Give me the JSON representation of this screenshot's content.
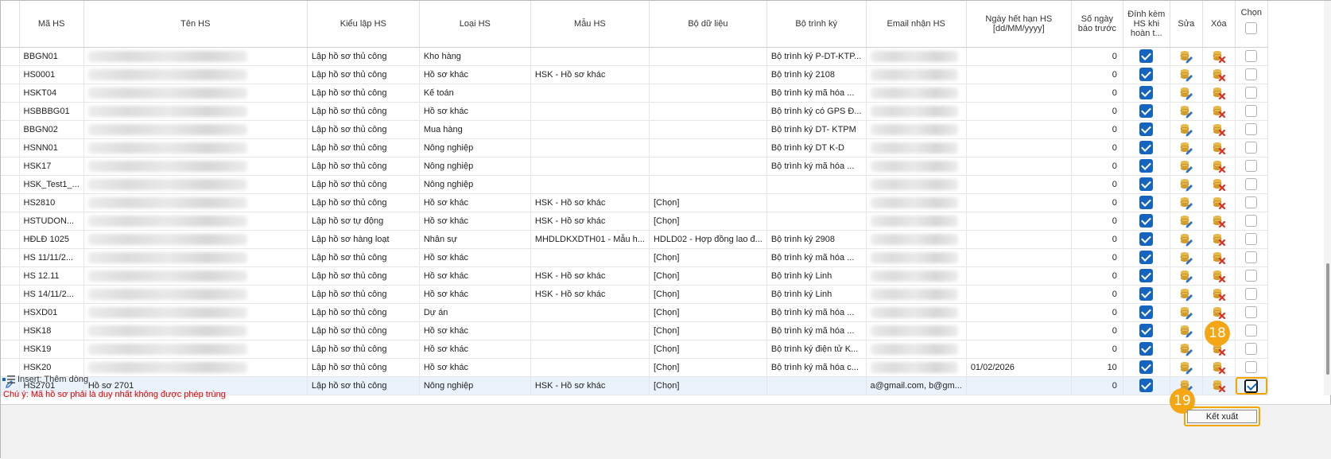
{
  "table": {
    "headers": {
      "ma_hs": "Mã HS",
      "ten_hs": "Tên HS",
      "kieu_lap_hs": "Kiểu lập HS",
      "loai_hs": "Loại HS",
      "mau_hs": "Mẫu HS",
      "bo_du_lieu": "Bộ dữ liệu",
      "bo_trinh_ky": "Bộ trình ký",
      "email_nhan_hs": "Email nhận HS",
      "ngay_het_han": "Ngày hết hạn HS [dd/MM/yyyy]",
      "so_ngay_bao_truoc": "Số ngày báo trước",
      "dinh_kem": "Đính kèm HS khi hoàn t...",
      "sua": "Sửa",
      "xoa": "Xóa",
      "chon": "Chọn"
    },
    "rows": [
      {
        "ma": "BBGN01",
        "ten": "",
        "kieu": "Lập hồ sơ thủ công",
        "loai": "Kho hàng",
        "mau": "",
        "bo_dl": "",
        "trinh_ky": "Bộ trình ký P-DT-KTP...",
        "email": "",
        "ngay": "",
        "so_ngay": "0",
        "dinh_kem": true,
        "chon": false
      },
      {
        "ma": "HS0001",
        "ten": "",
        "kieu": "Lập hồ sơ thủ công",
        "loai": "Hồ sơ khác",
        "mau": "HSK - Hồ sơ khác",
        "bo_dl": "",
        "trinh_ky": "Bộ trình ký 2108",
        "email": "",
        "ngay": "",
        "so_ngay": "0",
        "dinh_kem": true,
        "chon": false
      },
      {
        "ma": "HSKT04",
        "ten": "",
        "kieu": "Lập hồ sơ thủ công",
        "loai": "Kế toán",
        "mau": "",
        "bo_dl": "",
        "trinh_ky": "Bộ trình ký mã hóa ...",
        "email": "",
        "ngay": "",
        "so_ngay": "0",
        "dinh_kem": true,
        "chon": false
      },
      {
        "ma": "HSBBBG01",
        "ten": "",
        "kieu": "Lập hồ sơ thủ công",
        "loai": "Hồ sơ khác",
        "mau": "",
        "bo_dl": "",
        "trinh_ky": "Bộ trình ký có GPS Đ...",
        "email": "",
        "ngay": "",
        "so_ngay": "0",
        "dinh_kem": true,
        "chon": false
      },
      {
        "ma": "BBGN02",
        "ten": "",
        "kieu": "Lập hồ sơ thủ công",
        "loai": "Mua hàng",
        "mau": "",
        "bo_dl": "",
        "trinh_ky": "Bộ trình ký DT- KTPM",
        "email": "",
        "ngay": "",
        "so_ngay": "0",
        "dinh_kem": true,
        "chon": false
      },
      {
        "ma": "HSNN01",
        "ten": "",
        "kieu": "Lập hồ sơ thủ công",
        "loai": "Nông nghiệp",
        "mau": "",
        "bo_dl": "",
        "trinh_ky": "Bộ trình ký DT K-D",
        "email": "",
        "ngay": "",
        "so_ngay": "0",
        "dinh_kem": true,
        "chon": false
      },
      {
        "ma": "HSK17",
        "ten": "",
        "kieu": "Lập hồ sơ thủ công",
        "loai": "Nông nghiệp",
        "mau": "",
        "bo_dl": "",
        "trinh_ky": "Bộ trình ký mã hóa ...",
        "email": "",
        "ngay": "",
        "so_ngay": "0",
        "dinh_kem": true,
        "chon": false
      },
      {
        "ma": "HSK_Test1_...",
        "ten": "",
        "kieu": "Lập hồ sơ thủ công",
        "loai": "Nông nghiệp",
        "mau": "",
        "bo_dl": "",
        "trinh_ky": "",
        "email": "",
        "ngay": "",
        "so_ngay": "0",
        "dinh_kem": true,
        "chon": false
      },
      {
        "ma": "HS2810",
        "ten": "",
        "kieu": "Lập hồ sơ thủ công",
        "loai": "Hồ sơ khác",
        "mau": "HSK - Hồ sơ khác",
        "bo_dl": "[Chọn]",
        "trinh_ky": "",
        "email": "",
        "ngay": "",
        "so_ngay": "0",
        "dinh_kem": true,
        "chon": false
      },
      {
        "ma": "HSTUDON...",
        "ten": "",
        "kieu": "Lập hồ sơ tự động",
        "loai": "Hồ sơ khác",
        "mau": "HSK - Hồ sơ khác",
        "bo_dl": "[Chọn]",
        "trinh_ky": "",
        "email": "",
        "ngay": "",
        "so_ngay": "0",
        "dinh_kem": true,
        "chon": false
      },
      {
        "ma": "HĐLĐ 1025",
        "ten": "",
        "kieu": "Lập hồ sơ hàng loạt",
        "loai": "Nhân sự",
        "mau": "MHDLDKXDTH01 - Mẫu h...",
        "bo_dl": "HDLD02 - Hợp đồng lao đ...",
        "trinh_ky": "Bộ trình ký 2908",
        "email": "",
        "ngay": "",
        "so_ngay": "0",
        "dinh_kem": true,
        "chon": false
      },
      {
        "ma": "HS 11/11/2...",
        "ten": "",
        "kieu": "Lập hồ sơ thủ công",
        "loai": "Hồ sơ khác",
        "mau": "",
        "bo_dl": "[Chọn]",
        "trinh_ky": "Bộ trình ký mã hóa ...",
        "email": "",
        "ngay": "",
        "so_ngay": "0",
        "dinh_kem": true,
        "chon": false
      },
      {
        "ma": "HS 12.11",
        "ten": "",
        "kieu": "Lập hồ sơ thủ công",
        "loai": "Hồ sơ khác",
        "mau": "HSK - Hồ sơ khác",
        "bo_dl": "[Chọn]",
        "trinh_ky": "Bộ trình ký Linh",
        "email": "",
        "ngay": "",
        "so_ngay": "0",
        "dinh_kem": true,
        "chon": false
      },
      {
        "ma": "HS 14/11/2...",
        "ten": "",
        "kieu": "Lập hồ sơ thủ công",
        "loai": "Hồ sơ khác",
        "mau": "HSK - Hồ sơ khác",
        "bo_dl": "[Chọn]",
        "trinh_ky": "Bộ trình ký Linh",
        "email": "",
        "ngay": "",
        "so_ngay": "0",
        "dinh_kem": true,
        "chon": false
      },
      {
        "ma": "HSXD01",
        "ten": "",
        "kieu": "Lập hồ sơ thủ công",
        "loai": "Dự án",
        "mau": "",
        "bo_dl": "[Chọn]",
        "trinh_ky": "Bộ trình ký mã hóa ...",
        "email": "",
        "ngay": "",
        "so_ngay": "0",
        "dinh_kem": true,
        "chon": false
      },
      {
        "ma": "HSK18",
        "ten": "",
        "kieu": "Lập hồ sơ thủ công",
        "loai": "Hồ sơ khác",
        "mau": "",
        "bo_dl": "[Chọn]",
        "trinh_ky": "Bộ trình ký mã hóa ...",
        "email": "",
        "ngay": "",
        "so_ngay": "0",
        "dinh_kem": true,
        "chon": false
      },
      {
        "ma": "HSK19",
        "ten": "",
        "kieu": "Lập hồ sơ thủ công",
        "loai": "Hồ sơ khác",
        "mau": "",
        "bo_dl": "[Chọn]",
        "trinh_ky": "Bộ trình ký điện tử K...",
        "email": "",
        "ngay": "",
        "so_ngay": "0",
        "dinh_kem": true,
        "chon": false
      },
      {
        "ma": "HSK20",
        "ten": "",
        "kieu": "Lập hồ sơ thủ công",
        "loai": "Hồ sơ khác",
        "mau": "",
        "bo_dl": "[Chọn]",
        "trinh_ky": "Bộ trình ký mã hóa c...",
        "email": "",
        "ngay": "01/02/2026",
        "so_ngay": "10",
        "dinh_kem": true,
        "chon": false
      },
      {
        "ma": "HS2701",
        "ten": "Hồ sơ 2701",
        "kieu": "Lập hồ sơ thủ công",
        "loai": "Nông nghiệp",
        "mau": "HSK - Hồ sơ khác",
        "bo_dl": "[Chọn]",
        "trinh_ky": "",
        "email": "a@gmail.com, b@gm...",
        "ngay": "",
        "so_ngay": "0",
        "dinh_kem": true,
        "chon": true
      }
    ]
  },
  "insert_label": "Insert: Thêm dòng",
  "note": "Chú ý: Mã hồ sơ phải là duy nhất không được phép trùng",
  "export_label": "Kết xuất",
  "badges": {
    "select": "18",
    "export": "19"
  },
  "colors": {
    "accent": "#1565c0",
    "highlight": "#f2a600",
    "badge": "#f4a614",
    "note": "#e00000"
  }
}
